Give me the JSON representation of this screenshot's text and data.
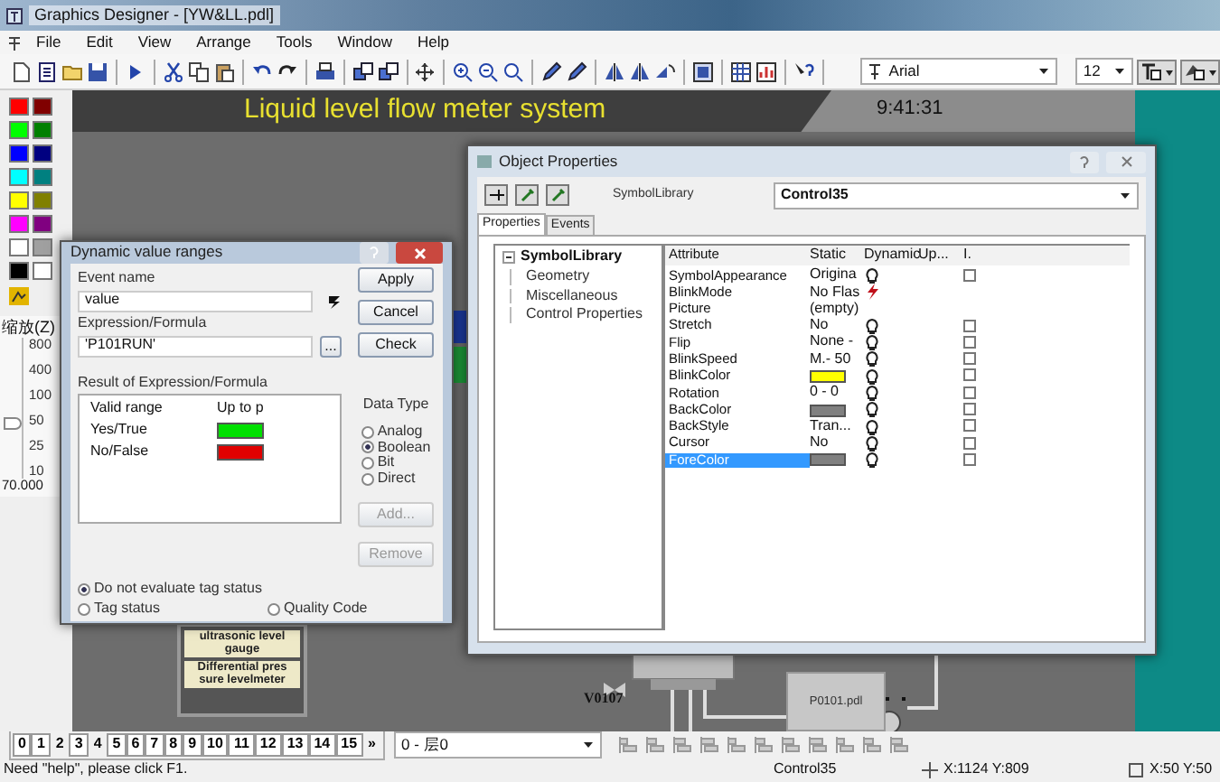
{
  "window": {
    "title": "Graphics Designer - [YW&LL.pdl]"
  },
  "menu": [
    "File",
    "Edit",
    "View",
    "Arrange",
    "Tools",
    "Window",
    "Help"
  ],
  "toolbar": {
    "font": "Arial",
    "font_size": "12"
  },
  "palette": [
    {
      "color": "#ff0000"
    },
    {
      "color": "#800000"
    },
    {
      "color": "#00ff00"
    },
    {
      "color": "#008000"
    },
    {
      "color": "#0000ff"
    },
    {
      "color": "#000080"
    },
    {
      "color": "#00ffff"
    },
    {
      "color": "#008080"
    },
    {
      "color": "#ffff00"
    },
    {
      "color": "#808000"
    },
    {
      "color": "#ff00ff"
    },
    {
      "color": "#800080"
    },
    {
      "color": "#ffffff"
    },
    {
      "color": "#a0a0a0"
    },
    {
      "color": "#000000"
    },
    {
      "color": "#ffffff"
    }
  ],
  "zoom": {
    "label": "缩放(Z)",
    "ticks": [
      "800",
      "400",
      "100",
      "50",
      "25",
      "10"
    ],
    "level": 0.4,
    "value": "70.000"
  },
  "canvas": {
    "title": "Liquid level flow meter system",
    "time": "9:41:31",
    "gauge_label": "ultrasonic level gauge",
    "meter_label": [
      "Differential pres",
      "sure levelmeter"
    ],
    "valve_label": "V0107",
    "pump_label": "P0101.pdl"
  },
  "dialog": {
    "title": "Dynamic value ranges",
    "event_label": "Event name",
    "event_value": "value",
    "expression_label": "Expression/Formula",
    "expression_value": "'P101RUN'",
    "browse": "...",
    "result_label": "Result of Expression/Formula",
    "columns": [
      "Valid range",
      "Up to p"
    ],
    "ranges": [
      {
        "label": "Yes/True",
        "color": "#00e000"
      },
      {
        "label": "No/False",
        "color": "#e00000"
      }
    ],
    "buttons": [
      "Apply",
      "Cancel",
      "Check"
    ],
    "data_type_label": "Data Type",
    "data_types": [
      {
        "label": "Analog",
        "selected": false
      },
      {
        "label": "Boolean",
        "selected": true
      },
      {
        "label": "Bit",
        "selected": false
      },
      {
        "label": "Direct",
        "selected": false
      }
    ],
    "add": {
      "label": "Add...",
      "disabled": true
    },
    "remove": {
      "label": "Remove",
      "disabled": true
    },
    "status_options": [
      {
        "label": "Do not evaluate tag status",
        "selected": true
      },
      {
        "label": "Tag status",
        "selected": false
      },
      {
        "label": "Quality Code",
        "selected": false
      }
    ]
  },
  "properties": {
    "title": "Object Properties",
    "type": "SymbolLibrary",
    "object": "Control35",
    "tabs": [
      {
        "label": "Properties",
        "selected": true
      },
      {
        "label": "Events",
        "selected": false
      }
    ],
    "tree": {
      "label": "SymbolLibrary",
      "expanded": true,
      "children": [
        {
          "label": "Geometry"
        },
        {
          "label": "Miscellaneous"
        },
        {
          "label": "Control Properties"
        }
      ]
    },
    "columns": [
      "Attribute",
      "Static",
      "Dynamic",
      "Up...",
      "I."
    ],
    "rows": [
      {
        "attribute": "SymbolAppearance",
        "kind": "text",
        "static": "Origina",
        "dynamic": {
          "kind": "bulb"
        },
        "checked": false,
        "selected": false
      },
      {
        "attribute": "BlinkMode",
        "kind": "text",
        "static": "No Flas",
        "dynamic": {
          "kind": "bolt"
        },
        "selected": false
      },
      {
        "attribute": "Picture",
        "kind": "text",
        "static": "(empty)",
        "selected": false
      },
      {
        "attribute": "Stretch",
        "kind": "text",
        "static": "No",
        "dynamic": {
          "kind": "bulb"
        },
        "checked": false,
        "selected": false
      },
      {
        "attribute": "Flip",
        "kind": "text",
        "static": "None -",
        "dynamic": {
          "kind": "bulb"
        },
        "checked": false,
        "selected": false
      },
      {
        "attribute": "BlinkSpeed",
        "kind": "text",
        "static": "M.- 50",
        "dynamic": {
          "kind": "bulb"
        },
        "checked": false,
        "selected": false
      },
      {
        "attribute": "BlinkColor",
        "kind": "color",
        "color": "#ffff00",
        "dynamic": {
          "kind": "bulb"
        },
        "checked": false,
        "selected": false
      },
      {
        "attribute": "Rotation",
        "kind": "text",
        "static": "0 - 0",
        "dynamic": {
          "kind": "bulb"
        },
        "checked": false,
        "selected": false
      },
      {
        "attribute": "BackColor",
        "kind": "color",
        "color": "#808080",
        "dynamic": {
          "kind": "bulb"
        },
        "checked": false,
        "selected": false
      },
      {
        "attribute": "BackStyle",
        "kind": "text",
        "static": "Tran...",
        "dynamic": {
          "kind": "bulb"
        },
        "checked": false,
        "selected": false
      },
      {
        "attribute": "Cursor",
        "kind": "text",
        "static": "No",
        "dynamic": {
          "kind": "bulb"
        },
        "checked": false,
        "selected": false
      },
      {
        "attribute": "ForeColor",
        "kind": "color",
        "color": "#808080",
        "dynamic": {
          "kind": "bulb"
        },
        "checked": false,
        "selected": true
      }
    ]
  },
  "layers": [
    {
      "label": "0",
      "on": true
    },
    {
      "label": "1",
      "on": true
    },
    {
      "label": "2",
      "on": false
    },
    {
      "label": "3",
      "on": true
    },
    {
      "label": "4",
      "on": false
    },
    {
      "label": "5",
      "on": true
    },
    {
      "label": "6",
      "on": true
    },
    {
      "label": "7",
      "on": true
    },
    {
      "label": "8",
      "on": true
    },
    {
      "label": "9",
      "on": true
    },
    {
      "label": "10",
      "on": true
    },
    {
      "label": "11",
      "on": true
    },
    {
      "label": "12",
      "on": true
    },
    {
      "label": "13",
      "on": true
    },
    {
      "label": "14",
      "on": true
    },
    {
      "label": "15",
      "on": true
    }
  ],
  "layers_more": "»",
  "layer_select": "0 - 层0",
  "status_bar": {
    "help": "Need \"help\", please click F1.",
    "object": "Control35",
    "position": "X:1124 Y:809",
    "size": "X:50 Y:50"
  }
}
